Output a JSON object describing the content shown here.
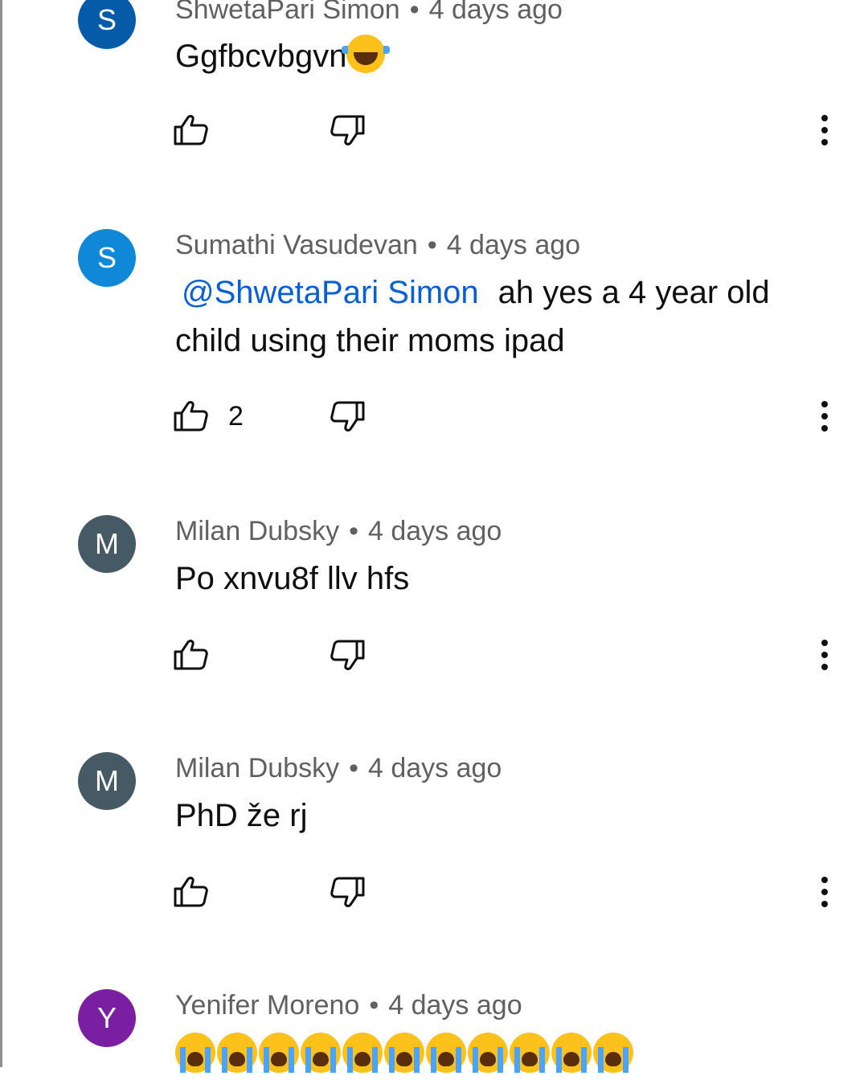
{
  "colors": {
    "avatar_shwetapari": "#065ba8",
    "avatar_sumathi": "#0f88d8",
    "avatar_milan": "#455a64",
    "avatar_yenifer": "#7b1fa2",
    "mention": "#065fd4",
    "meta_text": "#606060"
  },
  "comments": [
    {
      "author": "ShwetaPari Simon",
      "separator": "•",
      "time": "4 days ago",
      "initial": "S",
      "text": "Ggfbcvbgvn",
      "emoji": "face-with-tears-of-joy"
    },
    {
      "author": "Sumathi Vasudevan",
      "separator": "•",
      "time": "4 days ago",
      "initial": "S",
      "mention": "@ShwetaPari Simon",
      "text": "ah yes a 4 year old child using their moms ipad",
      "likes": "2"
    },
    {
      "author": "Milan Dubsky",
      "separator": "•",
      "time": "4 days ago",
      "initial": "M",
      "text": "Po xnvu8f llv hfs"
    },
    {
      "author": "Milan Dubsky",
      "separator": "•",
      "time": "4 days ago",
      "initial": "M",
      "text": "PhD že rj"
    },
    {
      "author": "Yenifer Moreno",
      "separator": "•",
      "time": "4 days ago",
      "initial": "Y",
      "emoji": "loudly-crying-face",
      "emoji_count": 11
    }
  ]
}
